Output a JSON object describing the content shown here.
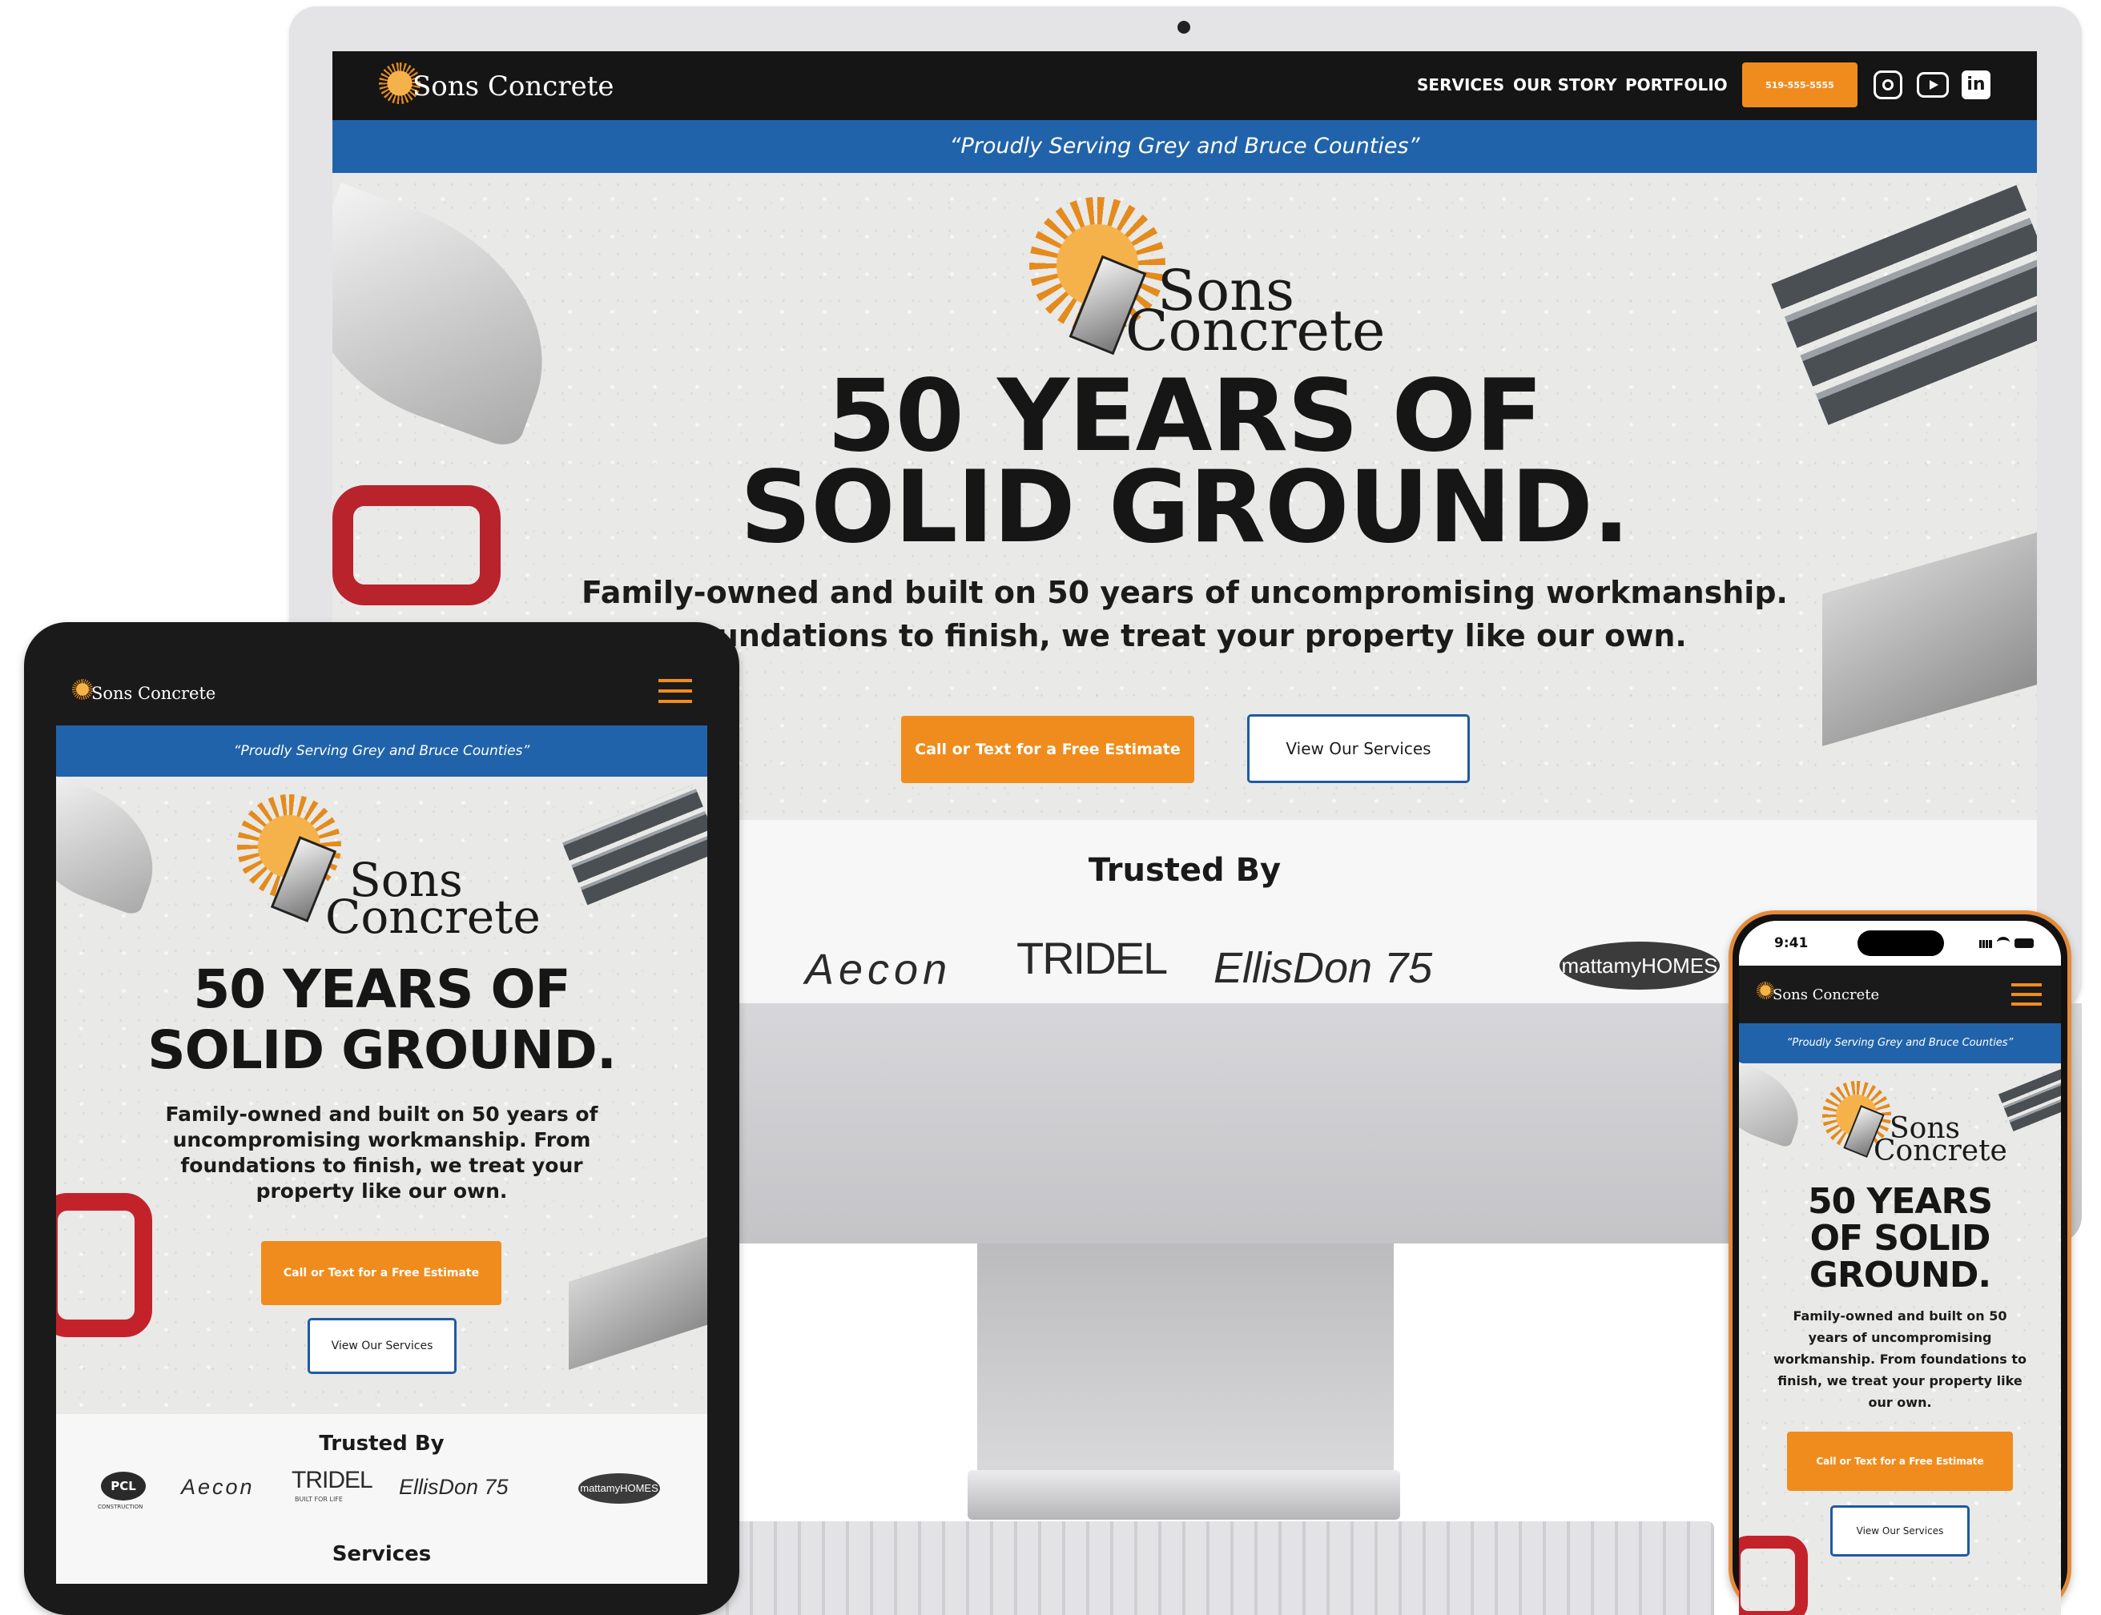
{
  "brand": {
    "name": "Sons Concrete",
    "logo_line1": "Sons",
    "logo_line2": "Concrete"
  },
  "desktop": {
    "nav": [
      "SERVICES",
      "OUR STORY",
      "PORTFOLIO"
    ],
    "phone_button": "519-555-5555",
    "social_icons": [
      "instagram-icon",
      "youtube-icon",
      "linkedin-icon"
    ],
    "tagline": "“Proudly Serving Grey and Bruce Counties”",
    "headline_line1": "50 YEARS OF",
    "headline_line2": "SOLID GROUND.",
    "subtext_line1": "Family-owned and built on 50 years of uncompromising workmanship.",
    "subtext_line2": "foundations to finish, we treat your property like our own.",
    "cta_primary": "Call or Text for a Free Estimate",
    "cta_secondary": "View Our Services",
    "trusted_title": "Trusted By",
    "partners": [
      "Aecon",
      "TRIDEL",
      "EllisDon 75",
      "mattamyHOMES"
    ]
  },
  "tablet": {
    "tagline": "“Proudly Serving Grey and Bruce Counties”",
    "headline_line1": "50 YEARS OF",
    "headline_line2": "SOLID GROUND.",
    "subtext": "Family-owned and built on 50 years of uncompromising workmanship. From foundations to finish, we treat your property like our own.",
    "cta_primary": "Call or Text for a Free Estimate",
    "cta_secondary": "View Our Services",
    "trusted_title": "Trusted By",
    "partners": [
      "PCL",
      "Aecon",
      "TRIDEL",
      "EllisDon 75",
      "mattamyHOMES"
    ],
    "partner_sub": {
      "pcl": "CONSTRUCTION",
      "tridel": "BUILT FOR LIFE"
    },
    "services_title": "Services"
  },
  "phone": {
    "status_time": "9:41",
    "tagline": "“Proudly Serving Grey and Bruce Counties”",
    "headline_line1": "50 YEARS",
    "headline_line2": "OF SOLID",
    "headline_line3": "GROUND.",
    "subtext": "Family-owned and built on 50 years of uncompromising workmanship. From foundations to finish, we treat your property like our own.",
    "cta_primary": "Call or Text for a Free Estimate",
    "cta_secondary": "View Our Services"
  },
  "colors": {
    "accent_orange": "#f08c1d",
    "tagline_blue": "#2163aa",
    "nav_black": "#151515"
  }
}
